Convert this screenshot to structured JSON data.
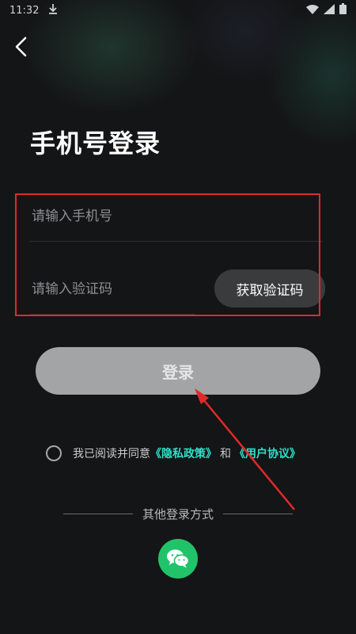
{
  "status_bar": {
    "time": "11:32"
  },
  "page": {
    "title": "手机号登录"
  },
  "form": {
    "phone_placeholder": "请输入手机号",
    "code_placeholder": "请输入验证码",
    "get_code_label": "获取验证码",
    "login_label": "登录"
  },
  "agreement": {
    "prefix": "我已阅读并同意",
    "privacy_link": "《隐私政策》",
    "and": "和",
    "terms_link": "《用户协议》",
    "checked": false
  },
  "other_login": {
    "label": "其他登录方式",
    "methods": [
      "wechat-icon"
    ]
  },
  "colors": {
    "accent_link": "#2fe0c8",
    "login_button": "#a3a4a5",
    "wechat": "#21c36a",
    "annotation": "#e02a2a"
  }
}
